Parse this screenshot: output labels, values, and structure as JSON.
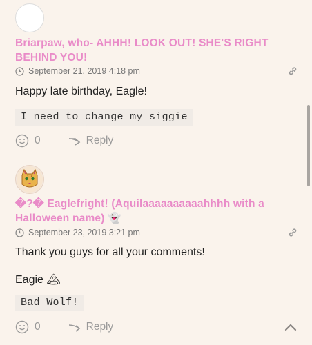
{
  "comments": [
    {
      "author": "Briarpaw, who- AHHH! LOOK OUT! SHE'S RIGHT BEHIND YOU!",
      "date": "September 21, 2019 4:18 pm",
      "body": [
        "Happy late birthday, Eagle!"
      ],
      "signature": "I need to change my siggie",
      "likes": "0",
      "reply_label": "Reply"
    },
    {
      "author": "�?� Eaglefright! (Aquilaaaaaaaaaahhhh with a Halloween name) 👻",
      "date": "September 23, 2019 3:21 pm",
      "body": [
        "Thank you guys for all your comments!",
        "Eagie 🏔"
      ],
      "signature": "Bad Wolf!",
      "likes": "0",
      "reply_label": "Reply"
    }
  ],
  "colors": {
    "author": "#e98bc8",
    "background": "#faf3ec",
    "muted": "#999999"
  },
  "icons": [
    "clock-icon",
    "link-icon",
    "smiley-icon",
    "reply-arrow-icon",
    "chevron-up-icon"
  ]
}
